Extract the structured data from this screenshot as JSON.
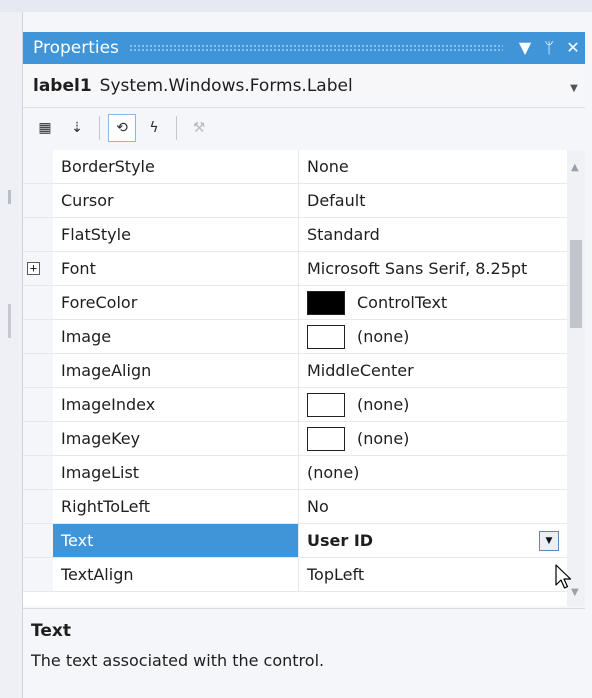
{
  "panel": {
    "title": "Properties",
    "buttons": {
      "dropdown": "▼",
      "pin": "ᛘ",
      "close": "✕"
    }
  },
  "selector": {
    "name": "label1",
    "type": "System.Windows.Forms.Label",
    "arrow": "▼"
  },
  "toolbar": {
    "buttons": [
      {
        "icon": "categorized-icon",
        "glyph": "▦"
      },
      {
        "icon": "alphabetical-icon",
        "glyph": "⇣"
      },
      {
        "icon": "properties-icon",
        "glyph": "⟲"
      },
      {
        "icon": "events-icon",
        "glyph": "ϟ"
      },
      {
        "icon": "property-pages-icon",
        "glyph": "⚒"
      }
    ]
  },
  "grid": {
    "rows": [
      {
        "name": "BorderStyle",
        "value": "None"
      },
      {
        "name": "Cursor",
        "value": "Default"
      },
      {
        "name": "FlatStyle",
        "value": "Standard"
      },
      {
        "name": "Font",
        "value": "Microsoft Sans Serif, 8.25pt",
        "expander": "+"
      },
      {
        "name": "ForeColor",
        "value": "ControlText",
        "swatch": "#000000"
      },
      {
        "name": "Image",
        "value": "(none)",
        "swatch": "#ffffff"
      },
      {
        "name": "ImageAlign",
        "value": "MiddleCenter"
      },
      {
        "name": "ImageIndex",
        "value": "(none)",
        "swatch": "#ffffff"
      },
      {
        "name": "ImageKey",
        "value": "(none)",
        "swatch": "#ffffff"
      },
      {
        "name": "ImageList",
        "value": "(none)"
      },
      {
        "name": "RightToLeft",
        "value": "No"
      },
      {
        "name": "Text",
        "value": "User ID",
        "selected": true
      },
      {
        "name": "TextAlign",
        "value": "TopLeft"
      }
    ]
  },
  "description": {
    "title": "Text",
    "text": "The text associated with the control."
  },
  "colors": {
    "accent": "#3f95d8",
    "selection_text": "#ffffff"
  }
}
